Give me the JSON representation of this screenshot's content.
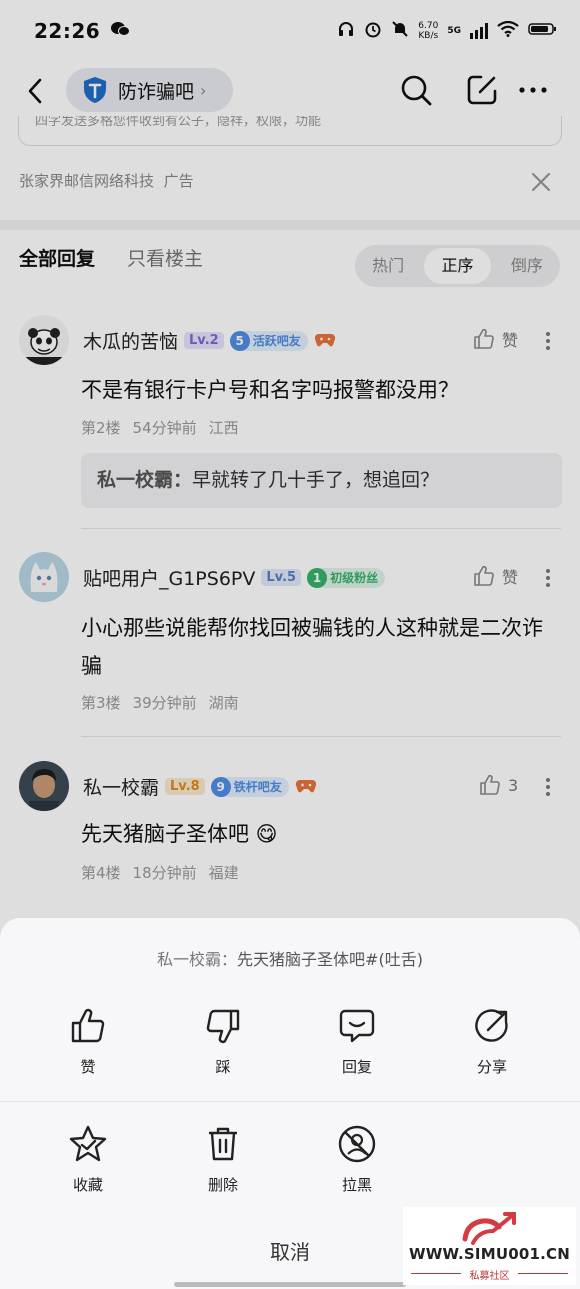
{
  "status_bar": {
    "time": "22:26",
    "speed_top": "6.70",
    "speed_bottom": "KB/s",
    "network": "5G"
  },
  "header": {
    "forum_name": "防诈骗吧"
  },
  "ad": {
    "clipped_text": "四字发送多格您件收到有公子，隐祥，权限，功能",
    "source": "张家界邮信网络科技",
    "tag": "广告"
  },
  "filter": {
    "tab_all": "全部回复",
    "tab_op": "只看楼主",
    "sort_hot": "热门",
    "sort_asc": "正序",
    "sort_desc": "倒序"
  },
  "comments": [
    {
      "user": "木瓜的苦恼",
      "level": "Lv.2",
      "badge_num": "5",
      "badge_text": "活跃吧友",
      "like_label": "赞",
      "text": "不是有银行卡户号和名字吗报警都没用？",
      "floor": "第2楼",
      "time": "54分钟前",
      "region": "江西",
      "reply_name": "私一校霸：",
      "reply_text": "早就转了几十手了，想追回？"
    },
    {
      "user": "贴吧用户_G1PS6PV",
      "level": "Lv.5",
      "badge_num": "1",
      "badge_text": "初级粉丝",
      "like_label": "赞",
      "text": "小心那些说能帮你找回被骗钱的人这种就是二次诈骗",
      "floor": "第3楼",
      "time": "39分钟前",
      "region": "湖南"
    },
    {
      "user": "私一校霸",
      "level": "Lv.8",
      "badge_num": "9",
      "badge_text": "铁杆吧友",
      "like_label": "3",
      "text": "先天猪脑子圣体吧 😋",
      "floor": "第4楼",
      "time": "18分钟前",
      "region": "福建"
    }
  ],
  "sheet": {
    "quote_name": "私一校霸：",
    "quote_text": "先天猪脑子圣体吧#(吐舌)",
    "actions": [
      "赞",
      "踩",
      "回复",
      "分享",
      "收藏",
      "删除",
      "拉黑"
    ],
    "cancel": "取消"
  },
  "watermark": {
    "site": "WWW.SIMU001.CN",
    "sub": "私募社区"
  },
  "colors": {
    "lv_purple": "#7a6bd6",
    "lv_blue": "#5a80c8",
    "lv_orange": "#e08a1e",
    "badge_blue": "#4f8fe6",
    "badge_green": "#37b36b",
    "watermark_red": "#c0333b"
  }
}
